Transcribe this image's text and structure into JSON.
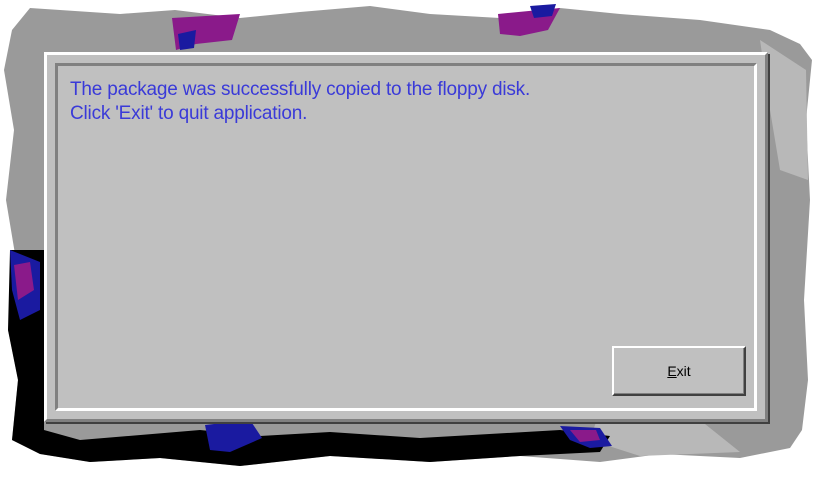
{
  "dialog": {
    "message_lines": [
      "The package was successfully copied to the floppy disk.",
      "Click 'Exit' to quit application."
    ],
    "exit_button": {
      "accelerator": "E",
      "rest": "xit"
    }
  },
  "colors": {
    "dialog_face": "#c0c0c0",
    "message_text": "#3a3ad8",
    "backdrop_gray": "#9a9a9a",
    "backdrop_purple": "#8a1a8a",
    "backdrop_blue": "#1a1aa0",
    "backdrop_black": "#000000"
  }
}
